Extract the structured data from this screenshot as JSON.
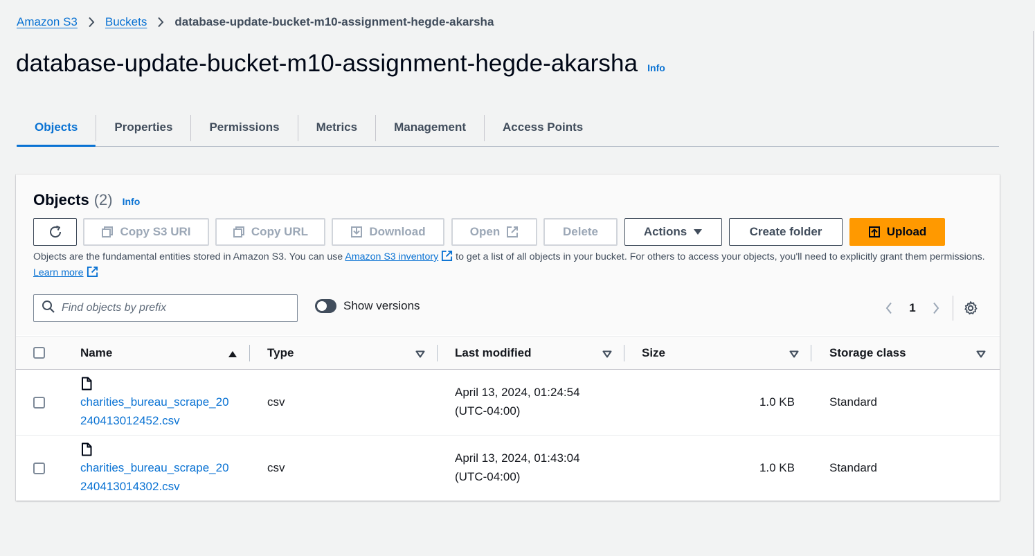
{
  "breadcrumb": {
    "items": [
      "Amazon S3",
      "Buckets"
    ],
    "current": "database-update-bucket-m10-assignment-hegde-akarsha"
  },
  "page": {
    "title": "database-update-bucket-m10-assignment-hegde-akarsha",
    "info": "Info"
  },
  "tabs": [
    {
      "label": "Objects",
      "active": true
    },
    {
      "label": "Properties"
    },
    {
      "label": "Permissions"
    },
    {
      "label": "Metrics"
    },
    {
      "label": "Management"
    },
    {
      "label": "Access Points"
    }
  ],
  "objects_panel": {
    "heading": "Objects",
    "count": "(2)",
    "info": "Info",
    "buttons": {
      "refresh_icon": "refresh-icon",
      "copy_s3_uri": "Copy S3 URI",
      "copy_url": "Copy URL",
      "download": "Download",
      "open": "Open",
      "delete": "Delete",
      "actions": "Actions",
      "create_folder": "Create folder",
      "upload": "Upload"
    },
    "description": {
      "part1": "Objects are the fundamental entities stored in Amazon S3. You can use ",
      "link1": "Amazon S3 inventory",
      "part2": " to get a list of all objects in your bucket. For others to access your objects, you'll need to explicitly grant them permissions. ",
      "link2": "Learn more"
    },
    "search": {
      "placeholder": "Find objects by prefix",
      "value": ""
    },
    "show_versions": {
      "label": "Show versions",
      "on": false
    },
    "pagination": {
      "current_page": "1"
    }
  },
  "table": {
    "columns": [
      "Name",
      "Type",
      "Last modified",
      "Size",
      "Storage class"
    ],
    "rows": [
      {
        "name_line1": "charities_bureau_scrape_20",
        "name_line2": "240413012452.csv",
        "type": "csv",
        "modified_line1": "April 13, 2024, 01:24:54",
        "modified_line2": "(UTC-04:00)",
        "size": "1.0 KB",
        "storage_class": "Standard"
      },
      {
        "name_line1": "charities_bureau_scrape_20",
        "name_line2": "240413014302.csv",
        "type": "csv",
        "modified_line1": "April 13, 2024, 01:43:04",
        "modified_line2": "(UTC-04:00)",
        "size": "1.0 KB",
        "storage_class": "Standard"
      }
    ]
  },
  "colors": {
    "link": "#0972d3",
    "primary_button": "#ff9900",
    "text": "#16191f",
    "background": "#f2f3f3"
  }
}
